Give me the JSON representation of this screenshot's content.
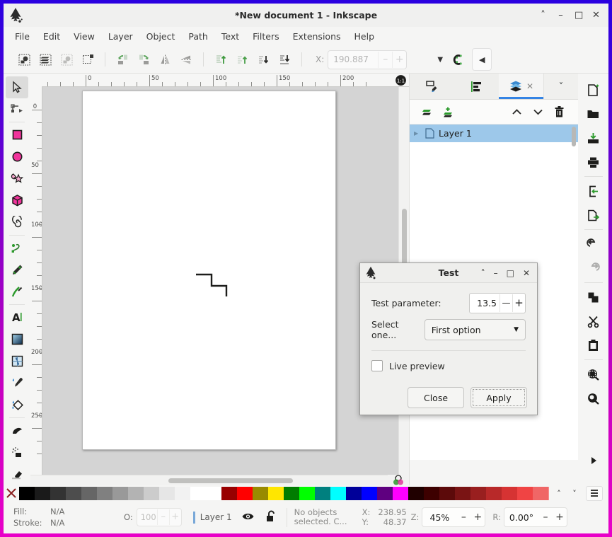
{
  "window": {
    "title": "*New document 1 - Inkscape",
    "buttons": [
      {
        "name": "shade",
        "glyph": "˄"
      },
      {
        "name": "minimize",
        "glyph": "–"
      },
      {
        "name": "maximize",
        "glyph": "□"
      },
      {
        "name": "close",
        "glyph": "✕"
      }
    ]
  },
  "menubar": {
    "items": [
      "File",
      "Edit",
      "View",
      "Layer",
      "Object",
      "Path",
      "Text",
      "Filters",
      "Extensions",
      "Help"
    ]
  },
  "toolbar": {
    "icons": [
      "select-all-icon",
      "select-all-in-all-layers-icon",
      "select-same-icon",
      "deselect-icon",
      "rotate-ccw-icon",
      "rotate-cw-icon",
      "flip-horizontal-icon",
      "flip-vertical-icon",
      "raise-to-top-icon",
      "raise-icon",
      "lower-icon",
      "lower-to-bottom-icon"
    ],
    "x_label": "X:",
    "x_value": "190.887",
    "minus": "–",
    "plus": "+",
    "overflow_glyph": "▼",
    "snap_icon": "snap-controls-icon",
    "collapse_glyph": "◀"
  },
  "toolbox": {
    "tools": [
      {
        "name": "selector-tool",
        "active": true
      },
      {
        "name": "node-tool",
        "active": false
      },
      {
        "name": "rectangle-tool",
        "active": false
      },
      {
        "name": "ellipse-tool",
        "active": false
      },
      {
        "name": "star-tool",
        "active": false
      },
      {
        "name": "3d-box-tool",
        "active": false
      },
      {
        "name": "spiral-tool",
        "active": false
      },
      {
        "name": "pencil-tool",
        "active": false
      },
      {
        "name": "pen-tool",
        "active": false
      },
      {
        "name": "calligraphy-tool",
        "active": false
      },
      {
        "name": "text-tool",
        "active": false
      },
      {
        "name": "gradient-tool",
        "active": false
      },
      {
        "name": "mesh-tool",
        "active": false
      },
      {
        "name": "dropper-tool",
        "active": false
      },
      {
        "name": "paint-bucket-tool",
        "active": false
      },
      {
        "name": "tweak-tool",
        "active": false
      },
      {
        "name": "spray-tool",
        "active": false
      },
      {
        "name": "eraser-tool",
        "active": false
      }
    ]
  },
  "rulers": {
    "horizontal": [
      "0",
      "50",
      "100",
      "150",
      "200"
    ],
    "vertical": [
      "0",
      "50",
      "100",
      "150",
      "200",
      "250"
    ],
    "zoom_1to1": "1:1"
  },
  "dock": {
    "tabs": [
      {
        "name": "tab-xml-editor",
        "icon": "xml-editor-icon",
        "selected": false,
        "closable": false
      },
      {
        "name": "tab-align",
        "icon": "align-icon",
        "selected": false,
        "closable": false
      },
      {
        "name": "tab-layers",
        "icon": "layers-icon",
        "selected": true,
        "closable": true,
        "close_glyph": "✕"
      },
      {
        "name": "tab-overflow",
        "icon": "chevron-down-icon",
        "selected": false,
        "closable": false,
        "glyph": "˅"
      }
    ],
    "layer_tools": [
      {
        "name": "toggle-current-layer-icon",
        "glyph": ""
      },
      {
        "name": "add-layer-icon",
        "glyph": ""
      },
      {
        "name": "raise-layer-icon",
        "glyph": "˄"
      },
      {
        "name": "lower-layer-icon",
        "glyph": "˅"
      },
      {
        "name": "delete-layer-icon",
        "glyph": ""
      }
    ],
    "layers": [
      {
        "name": "Layer 1",
        "selected": true,
        "expander": "▶"
      }
    ]
  },
  "command_bar": {
    "items": [
      "new-document-icon",
      "open-document-icon",
      "save-document-icon",
      "print-document-icon",
      "import-icon",
      "export-icon",
      "undo-icon",
      "redo-icon",
      "duplicate-icon",
      "cut-icon",
      "paste-icon",
      "zoom-selection-icon",
      "zoom-drawing-icon",
      "expand-arrow-icon"
    ]
  },
  "dialog": {
    "title": "Test",
    "icon": "inkscape-logo-icon",
    "window_buttons": [
      {
        "name": "shade",
        "glyph": "˄"
      },
      {
        "name": "minimize",
        "glyph": "–"
      },
      {
        "name": "maximize",
        "glyph": "□"
      },
      {
        "name": "close",
        "glyph": "✕"
      }
    ],
    "param_label": "Test parameter:",
    "param_value": "13.5",
    "param_minus": "—",
    "param_plus": "+",
    "select_label": "Select one...",
    "select_value": "First option",
    "select_arrow": "▼",
    "checkbox_label": "Live preview",
    "checkbox_checked": false,
    "close_button": "Close",
    "apply_button": "Apply"
  },
  "palette": {
    "x_glyph": "✕",
    "colors": [
      "#000000",
      "#1a1a1a",
      "#333333",
      "#4d4d4d",
      "#666666",
      "#808080",
      "#999999",
      "#b3b3b3",
      "#cccccc",
      "#e6e6e6",
      "#f2f2f2",
      "#ffffff",
      "#ffffff",
      "#990000",
      "#ff0000",
      "#998a00",
      "#ffe600",
      "#007c00",
      "#00ff00",
      "#00807f",
      "#00ffff",
      "#000099",
      "#0000ff",
      "#5f0080",
      "#ff00ff",
      "#200000",
      "#3d0000",
      "#5c0a0a",
      "#7a1414",
      "#991f1f",
      "#b82929",
      "#d63333",
      "#f04444",
      "#f06666",
      "#f58f8f",
      "#f7b3b3",
      "#fad5d5",
      "#2b0f0f",
      "#3d1a1a",
      "#502424",
      "#632e2e",
      "#773838",
      "#8a4242",
      "#9c5050",
      "#ae6060"
    ],
    "scroll_up": "˄",
    "scroll_down": "˅",
    "menu_icon": "palette-menu-icon"
  },
  "statusbar": {
    "fill_label": "Fill:",
    "fill_value": "N/A",
    "stroke_label": "Stroke:",
    "stroke_value": "N/A",
    "opacity_label": "O:",
    "opacity_value": "100",
    "opacity_minus": "–",
    "opacity_plus": "+",
    "layer_name": "Layer 1",
    "visibility_icon": "eye-icon",
    "lock_icon": "unlocked-icon",
    "selection_message": "No objects selected. C...",
    "x_label": "X:",
    "x_value": "238.95",
    "y_label": "Y:",
    "y_value": "48.37",
    "zoom_label": "Z:",
    "zoom_value": "45%",
    "zoom_minus": "–",
    "zoom_plus": "+",
    "rotation_label": "R:",
    "rotation_value": "0.00°",
    "rotation_minus": "–",
    "rotation_plus": "+"
  },
  "canvas": {
    "cms_icon": "color-managed-view-icon",
    "drawing": "staircase-path"
  }
}
